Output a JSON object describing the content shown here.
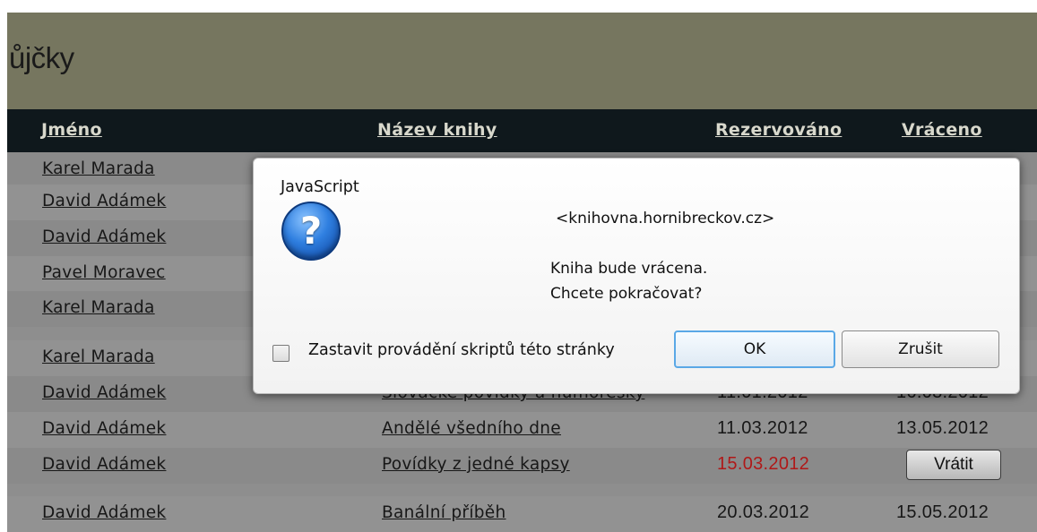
{
  "header": {
    "title": "ůjčky"
  },
  "table": {
    "columns": {
      "edge": "",
      "name": "Jméno",
      "title": "Název knihy",
      "reserved": "Rezervováno",
      "returned": "Vráceno"
    },
    "rows": [
      {
        "name": "Karel Marada",
        "title": "",
        "reserved": "",
        "returned": ""
      },
      {
        "name": "David Adámek",
        "title": "",
        "reserved": "",
        "returned": ""
      },
      {
        "name": "David Adámek",
        "title": "",
        "reserved": "",
        "returned": ""
      },
      {
        "name": "Pavel Moravec",
        "title": "",
        "reserved": "",
        "returned": ""
      },
      {
        "name": "Karel Marada",
        "title": "",
        "reserved": "",
        "returned": ""
      },
      {
        "name": "Karel Marada",
        "title": "",
        "reserved": "",
        "returned": ""
      },
      {
        "name": "David Adámek",
        "title": "Slovácké povídky a humoresky",
        "reserved": "11.01.2012",
        "returned": "16.03.2012"
      },
      {
        "name": "David Adámek",
        "title": "Andělé všedního dne",
        "reserved": "11.03.2012",
        "returned": "13.05.2012"
      },
      {
        "name": "David Adámek",
        "title": "Povídky z jedné kapsy",
        "reserved": "15.03.2012",
        "returned": "",
        "return_button": "Vrátit"
      },
      {
        "name": "David Adámek",
        "title": "Banální příběh",
        "reserved": "20.03.2012",
        "returned": "15.05.2012"
      }
    ],
    "late_color": "#b01818"
  },
  "dialog": {
    "title": "JavaScript",
    "icon": "question-icon",
    "origin": "<knihovna.hornibreckov.cz>",
    "message_line1": "Kniha bude vrácena.",
    "message_line2": "Chcete pokračovat?",
    "checkbox_label": "Zastavit provádění skriptů této stránky",
    "checkbox_checked": false,
    "ok_label": "OK",
    "cancel_label": "Zrušit"
  }
}
